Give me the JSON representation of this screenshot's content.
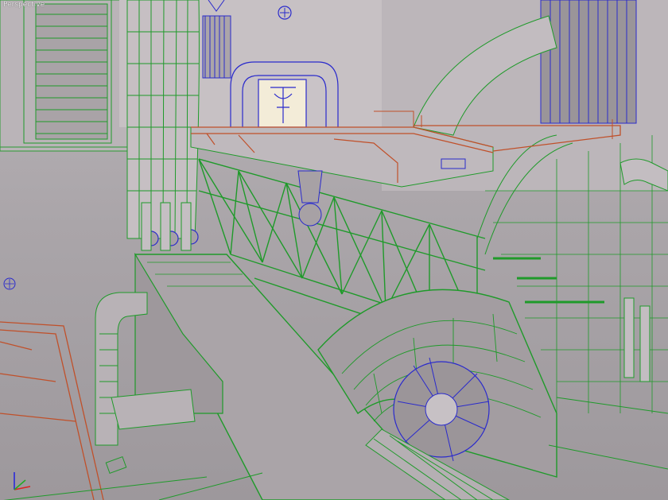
{
  "viewport": {
    "label": "Perspective",
    "view_mode": "wireframe-over-shaded"
  },
  "colors": {
    "background": "#aaa5a9",
    "wall": "#bdb7bb",
    "wall_dark": "#9c979b",
    "green_wire": "#1f9a2a",
    "blue_wire": "#2a2acc",
    "orange_wire": "#c0502a",
    "accent_light": "#f3ecd8"
  },
  "icons": {
    "axis_gizmo": "axis-tripod-icon"
  }
}
